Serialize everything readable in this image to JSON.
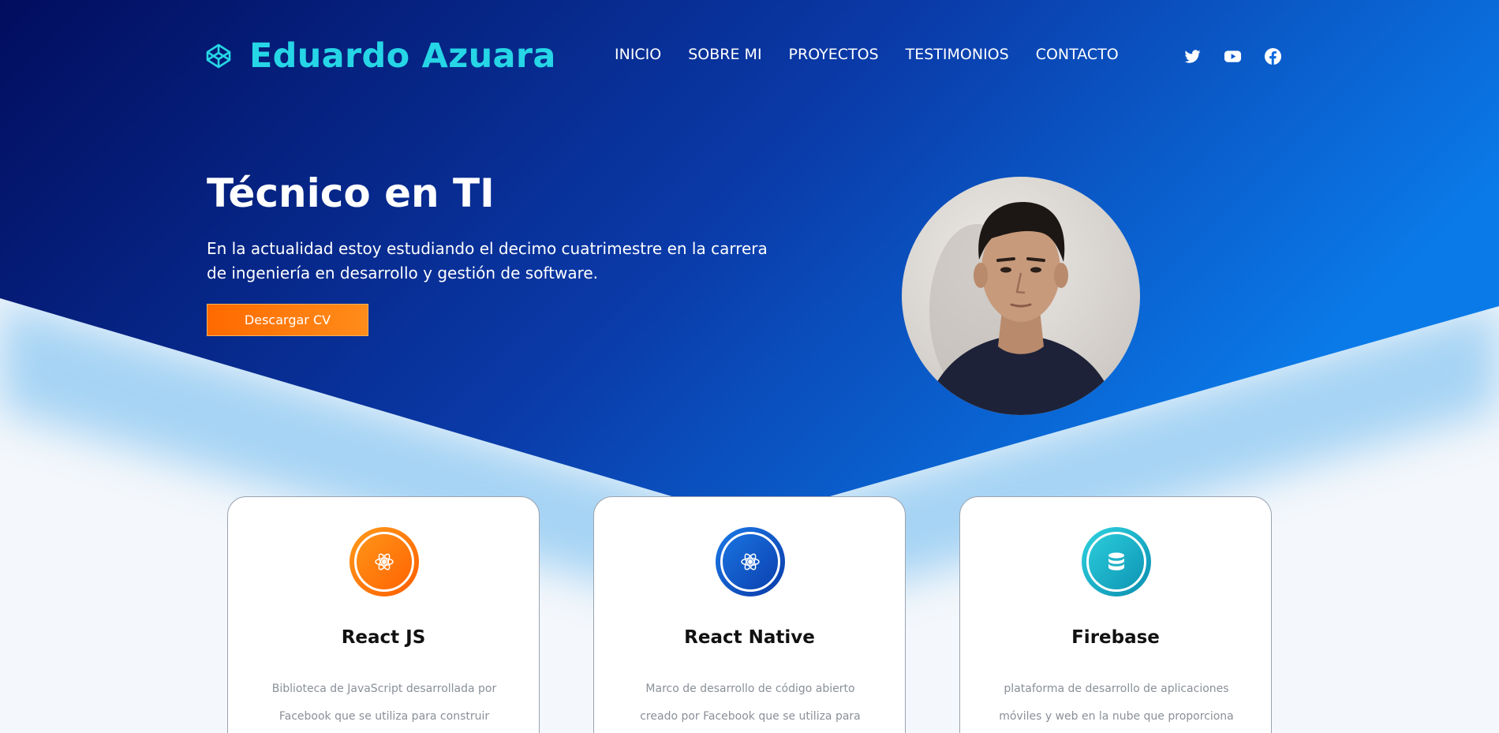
{
  "brand": {
    "name": "Eduardo Azuara",
    "icon": "codepen-icon"
  },
  "nav": {
    "items": [
      {
        "label": "INICIO"
      },
      {
        "label": "SOBRE MI"
      },
      {
        "label": "PROYECTOS"
      },
      {
        "label": "TESTIMONIOS"
      },
      {
        "label": "CONTACTO"
      }
    ],
    "social": [
      "twitter-icon",
      "youtube-icon",
      "facebook-icon"
    ]
  },
  "hero": {
    "title": "Técnico en TI",
    "description": "En la actualidad estoy estudiando el decimo cuatrimestre en la carrera de ingeniería en desarrollo y gestión de software.",
    "cta_label": "Descargar CV"
  },
  "colors": {
    "hero_dark": "#020d5e",
    "hero_mid": "#0a3aa8",
    "hero_light": "#0a7ae8",
    "accent_cyan": "#26d6e6",
    "button_orange": "#ff6a00"
  },
  "cards": [
    {
      "title": "React JS",
      "description": "Biblioteca de JavaScript desarrollada por Facebook que se utiliza para construir",
      "icon": "react-icon",
      "color": "#ff7a00"
    },
    {
      "title": "React Native",
      "description": "Marco de desarrollo de código abierto creado por Facebook que se utiliza para construir",
      "icon": "react-icon",
      "color": "#0a4fc6"
    },
    {
      "title": "Firebase",
      "description": "plataforma de desarrollo de aplicaciones móviles y web en la nube que proporciona una",
      "icon": "database-icon",
      "color": "#12b3c4"
    }
  ]
}
